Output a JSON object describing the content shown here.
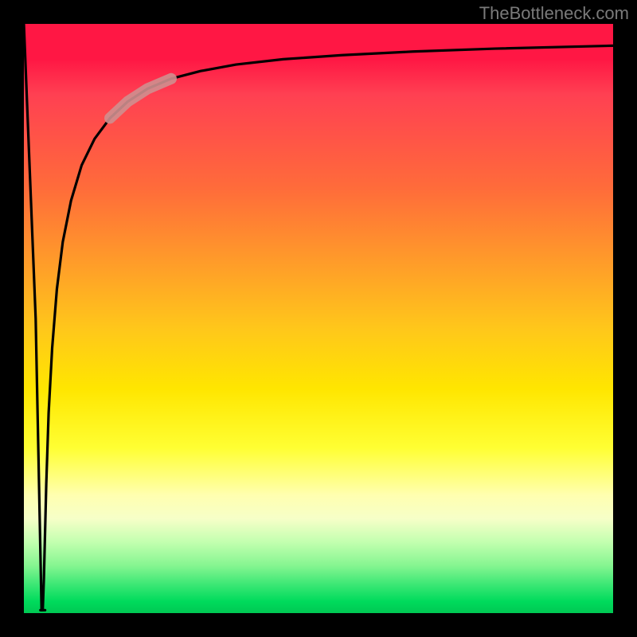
{
  "attribution": "TheBottleneck.com",
  "colors": {
    "frame": "#000000",
    "curve": "#000000",
    "highlight": "#cf8f8f",
    "gradient_stops": [
      "#ff1744",
      "#ff6c3a",
      "#ffc81a",
      "#ffff33",
      "#f6ffc8",
      "#00c853"
    ]
  },
  "chart_data": {
    "type": "line",
    "title": "",
    "xlabel": "",
    "ylabel": "",
    "xlim": [
      0,
      100
    ],
    "ylim": [
      0,
      100
    ],
    "grid": false,
    "legend": false,
    "series": [
      {
        "name": "curve",
        "x": [
          0.0,
          2.0,
          3.0,
          3.2,
          3.4,
          3.6,
          3.8,
          4.2,
          4.8,
          5.6,
          6.6,
          8.0,
          9.8,
          12.0,
          14.6,
          17.6,
          21.0,
          25.0,
          30.0,
          36.0,
          44.0,
          54.0,
          66.0,
          80.0,
          100.0
        ],
        "y": [
          100.0,
          50.0,
          0.5,
          0.5,
          6.0,
          14.0,
          22.0,
          34.0,
          45.0,
          55.0,
          63.0,
          70.0,
          76.0,
          80.5,
          84.0,
          86.8,
          89.0,
          90.7,
          92.0,
          93.1,
          94.0,
          94.7,
          95.3,
          95.8,
          96.3
        ]
      },
      {
        "name": "highlight-segment",
        "x": [
          14.6,
          17.6,
          21.0,
          25.0
        ],
        "y": [
          84.0,
          86.8,
          89.0,
          90.7
        ]
      }
    ],
    "notch": {
      "x_range": [
        2.8,
        3.6
      ],
      "y": 0.5
    }
  }
}
